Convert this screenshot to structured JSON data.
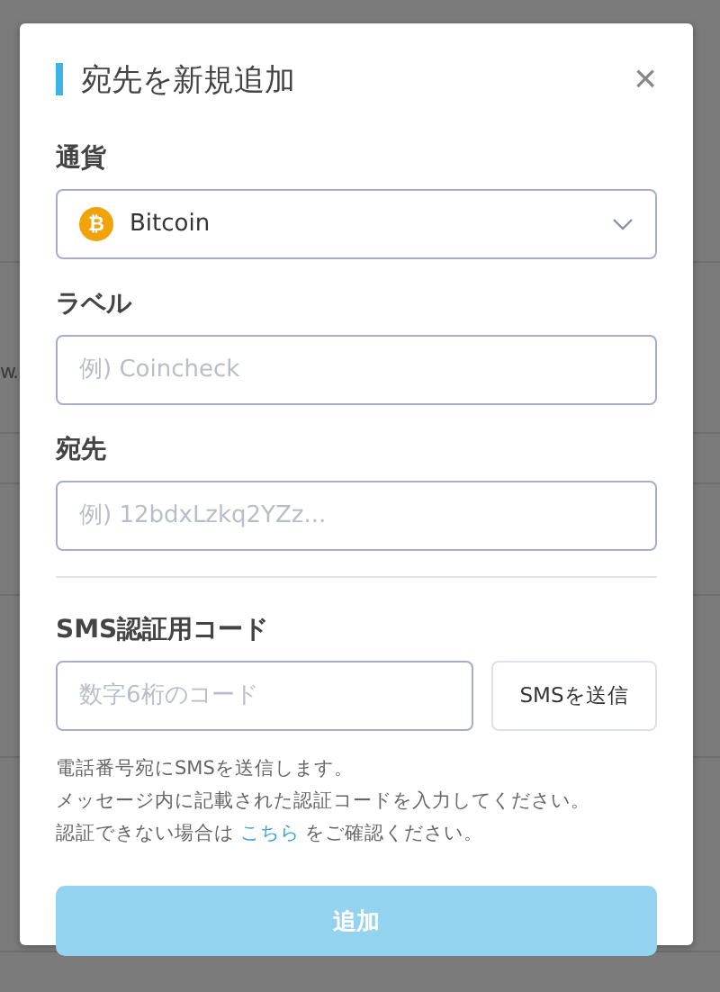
{
  "background": {
    "text": "w."
  },
  "dialog": {
    "title": "宛先を新規追加",
    "close": "×"
  },
  "fields": [
    {
      "kind": "select",
      "label": "通貨",
      "value": "Bitcoin",
      "coin_symbol": "₿"
    },
    {
      "kind": "input",
      "label": "ラベル",
      "placeholder": "例) Coincheck"
    },
    {
      "kind": "input",
      "label": "宛先",
      "placeholder": "例) 12bdxLzkq2YZz..."
    }
  ],
  "sms": {
    "label": "SMS認証用コード",
    "placeholder": "数字6桁のコード",
    "button": "SMSを送信"
  },
  "notes": {
    "line_1": "電話番号宛にSMSを送信します。",
    "line_2": "メッセージ内に記載された認証コードを入力してください。",
    "line_3_before": "認証できない場合は",
    "link": "こちら",
    "line_3_after": "をご確認ください。"
  },
  "submit": {
    "label": "追加",
    "disabled": true
  }
}
